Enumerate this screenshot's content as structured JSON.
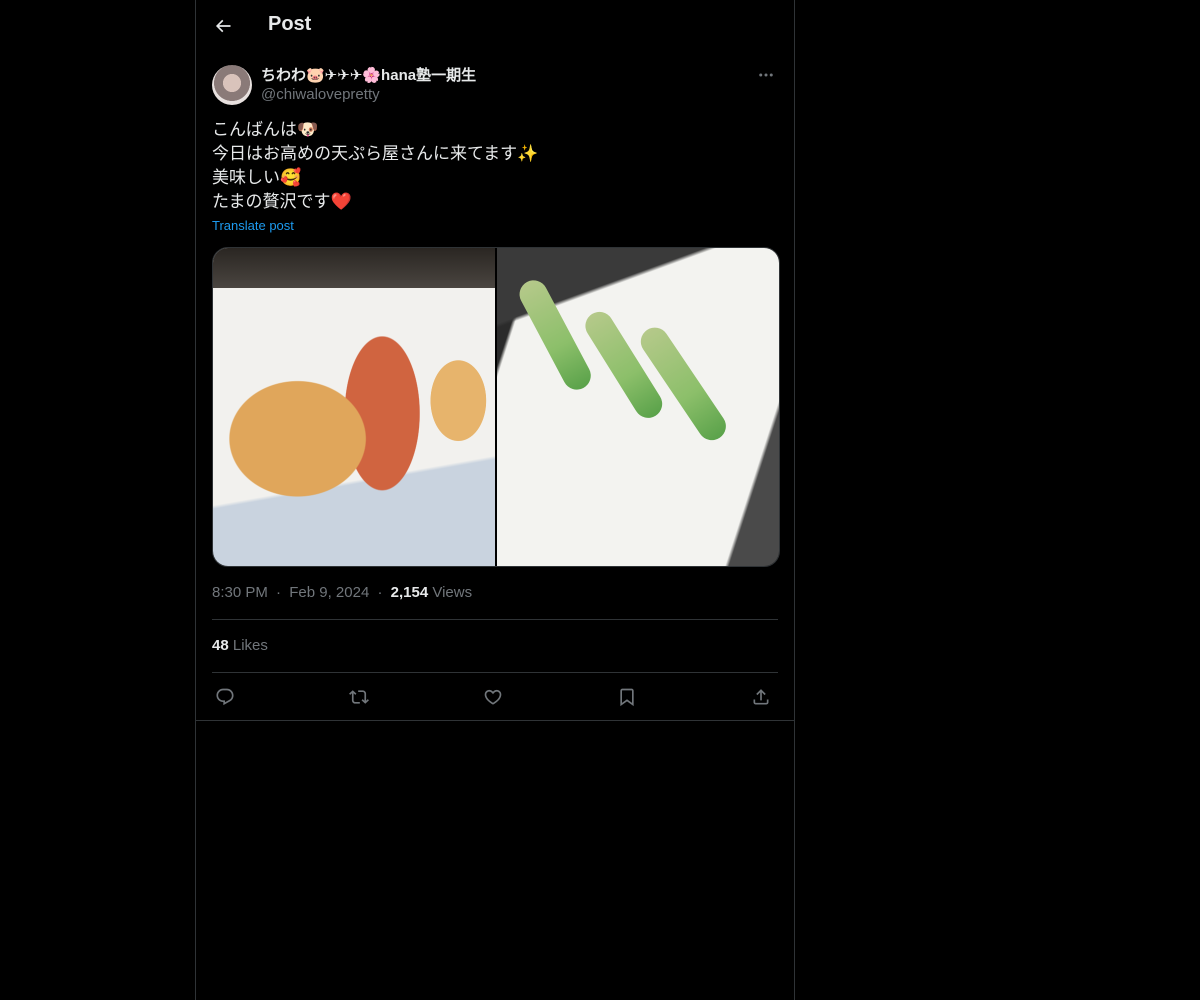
{
  "header": {
    "title": "Post",
    "back_icon": "arrow-left-icon"
  },
  "author": {
    "display_name": "ちわわ🐷✈✈✈🌸hana塾一期生",
    "handle": "@chiwalovepretty"
  },
  "post": {
    "lines": [
      "こんばんは🐶",
      "今日はお高めの天ぷら屋さんに来てます✨",
      "美味しい🥰",
      "たまの贅沢です❤️"
    ],
    "translate_label": "Translate post"
  },
  "media": {
    "count": 2,
    "items": [
      "shrimp-tempura",
      "asparagus-tempura"
    ]
  },
  "meta": {
    "time": "8:30 PM",
    "separator": "·",
    "date": "Feb 9, 2024",
    "views_count": "2,154",
    "views_label": "Views"
  },
  "stats": {
    "likes_count": "48",
    "likes_label": "Likes"
  },
  "actions": [
    "reply-icon",
    "repost-icon",
    "like-icon",
    "bookmark-icon",
    "share-icon"
  ],
  "colors": {
    "background": "#000000",
    "text": "#e7e9ea",
    "secondary": "#71767b",
    "border": "#2f3336",
    "accent": "#1d9bf0"
  }
}
